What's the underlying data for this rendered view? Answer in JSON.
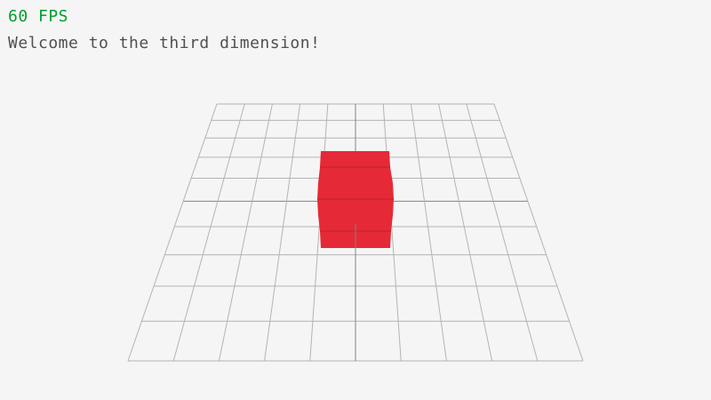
{
  "hud": {
    "fps_text": "60 FPS",
    "fps_color": "#009e2f",
    "message": "Welcome to the third dimension!",
    "message_color": "#505050"
  },
  "scene": {
    "background_color": "#f5f5f5",
    "grid_line_color": "#b4b4b4",
    "grid_axis_color": "#828282",
    "cube_color": "#e62937",
    "cube_edge_color": "#be1e2d"
  }
}
